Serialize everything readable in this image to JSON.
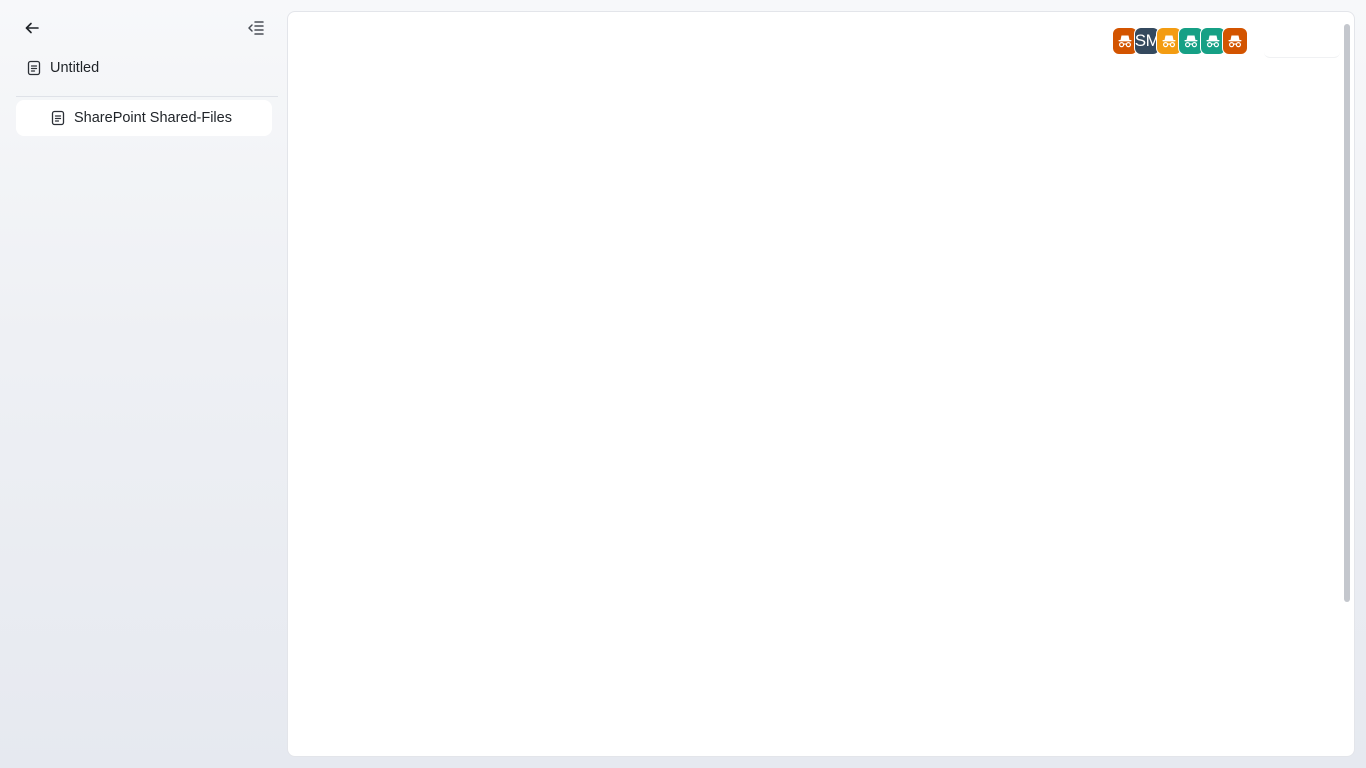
{
  "sidebar": {
    "back_icon": "arrow-left-icon",
    "collapse_icon": "collapse-sidebar-icon",
    "root_page": {
      "label": "Untitled",
      "icon": "page-icon"
    },
    "child_page": {
      "label": "SharePoint Shared-Files",
      "icon": "page-icon",
      "active": true
    }
  },
  "presence": {
    "avatars": [
      {
        "type": "incognito-icon",
        "color": "#d35400",
        "label": ""
      },
      {
        "type": "initials",
        "color": "#34495e",
        "label": "SM"
      },
      {
        "type": "incognito-icon",
        "color": "#f39c12",
        "label": ""
      },
      {
        "type": "incognito-icon",
        "color": "#16a085",
        "label": ""
      },
      {
        "type": "incognito-icon",
        "color": "#16a085",
        "label": ""
      },
      {
        "type": "incognito-icon",
        "color": "#d35400",
        "label": ""
      }
    ]
  }
}
